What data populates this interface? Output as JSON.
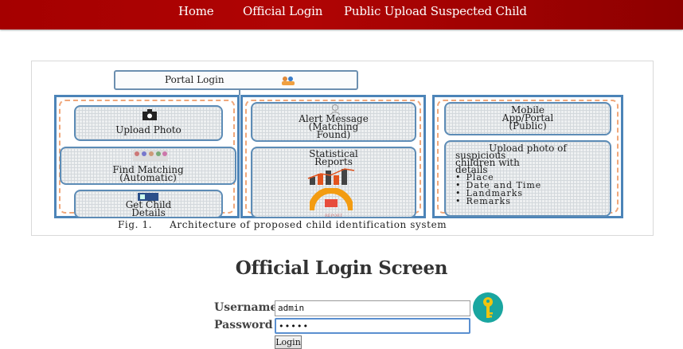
{
  "nav": {
    "home": "Home",
    "official_login": "Official Login",
    "public_upload": "Public Upload Suspected Child"
  },
  "figure": {
    "portal_login": "Portal Login",
    "upload_photo": "Upload Photo",
    "find_matching_1": "Find Matching",
    "find_matching_2": "(Automatic)",
    "get_child_1": "Get Child",
    "get_child_2": "Details",
    "alert_1": "Alert Message",
    "alert_2": "(Matching",
    "alert_3": "Found)",
    "stat_1": "Statistical",
    "stat_2": "Reports",
    "stat_3": "REPORT",
    "mobile_1": "Mobile",
    "mobile_2": "App/Portal",
    "mobile_3": "(Public)",
    "upload_1": "Upload photo of",
    "upload_2": "suspicious",
    "upload_3": "children with",
    "upload_4": "details",
    "items": [
      "Place",
      "Date and Time",
      "Landmarks",
      "Remarks"
    ],
    "caption_label": "Fig. 1.",
    "caption_text": "Architecture of proposed child identification system"
  },
  "login": {
    "title": "Official Login Screen",
    "username_label": "Username",
    "username_value": "admin",
    "password_label": "Password",
    "password_value": "•••••",
    "button": "Login"
  },
  "icons": {
    "login_icon": "key-icon"
  },
  "colors": {
    "nav_bg": "#a50000",
    "key_circle": "#1aa6a0",
    "key": "#f1c40f",
    "panel_border": "#4c84b8"
  }
}
